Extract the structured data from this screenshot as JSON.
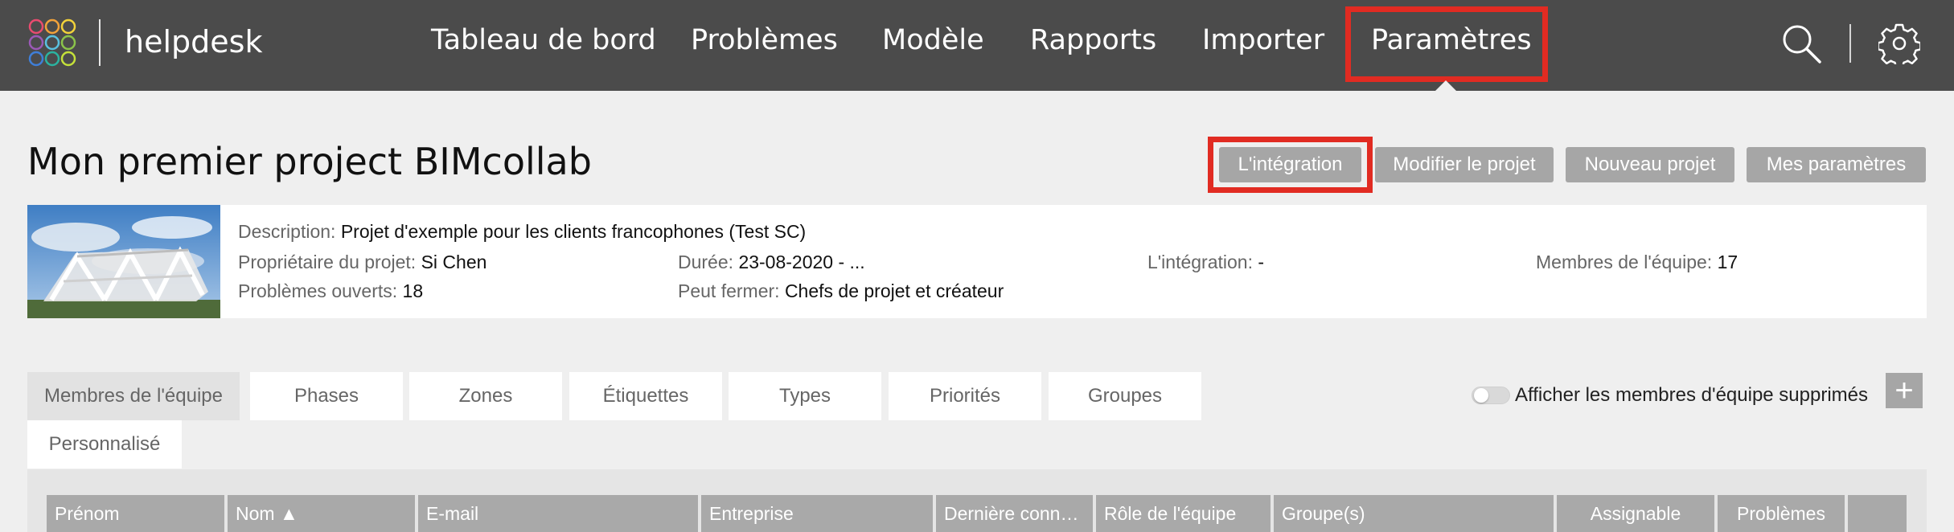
{
  "app": {
    "brand": "helpdesk"
  },
  "nav": {
    "items": [
      {
        "label": "Tableau de bord"
      },
      {
        "label": "Problèmes"
      },
      {
        "label": "Modèle"
      },
      {
        "label": "Rapports"
      },
      {
        "label": "Importer"
      },
      {
        "label": "Paramètres"
      }
    ],
    "active": "Paramètres"
  },
  "header": {
    "title": "Mon premier project BIMcollab",
    "buttons": [
      {
        "label": "L'intégration"
      },
      {
        "label": "Modifier le projet"
      },
      {
        "label": "Nouveau projet"
      },
      {
        "label": "Mes paramètres"
      }
    ]
  },
  "project": {
    "description_label": "Description:",
    "description": "Projet d'exemple pour les clients francophones (Test SC)",
    "owner_label": "Propriétaire du projet:",
    "owner": "Si Chen",
    "duration_label": "Durée:",
    "duration": "23-08-2020 - ...",
    "integration_label": "L'intégration:",
    "integration": "-",
    "members_label": "Membres de l'équipe:",
    "members": "17",
    "open_issues_label": "Problèmes ouverts:",
    "open_issues": "18",
    "can_close_label": "Peut fermer:",
    "can_close": "Chefs de projet et créateur"
  },
  "tabs": [
    {
      "label": "Membres de l'équipe"
    },
    {
      "label": "Phases"
    },
    {
      "label": "Zones"
    },
    {
      "label": "Étiquettes"
    },
    {
      "label": "Types"
    },
    {
      "label": "Priorités"
    },
    {
      "label": "Groupes"
    },
    {
      "label": "Personnalisé"
    }
  ],
  "active_tab": "Membres de l'équipe",
  "toggle": {
    "label": "Afficher les membres d'équipe supprimés",
    "checked": false
  },
  "add_label": "+",
  "table": {
    "columns": [
      {
        "label": "Prénom"
      },
      {
        "label": "Nom ▲"
      },
      {
        "label": "E-mail"
      },
      {
        "label": "Entreprise"
      },
      {
        "label": "Dernière conn…"
      },
      {
        "label": "Rôle de l'équipe"
      },
      {
        "label": "Groupe(s)"
      },
      {
        "label": "Assignable"
      },
      {
        "label": "Problèmes"
      },
      {
        "label": ""
      }
    ]
  },
  "colors": {
    "topbar": "#4b4b4b",
    "highlight": "#e12b22",
    "button": "#a6a6a6",
    "page_bg": "#efefef"
  }
}
